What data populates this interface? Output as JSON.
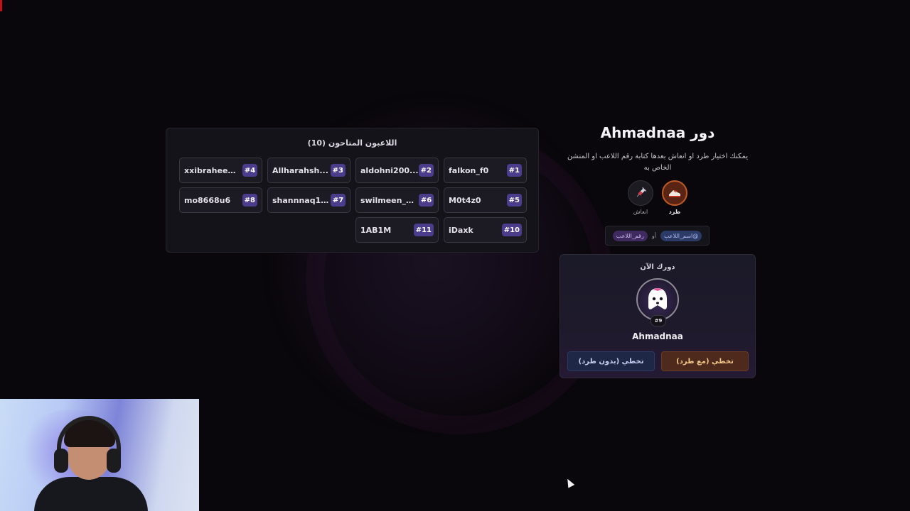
{
  "players_panel": {
    "title": "اللاعبون المتاحون (10)",
    "players": [
      {
        "name": "falkon_f0",
        "num": "#1"
      },
      {
        "name": "aldohni200...",
        "num": "#2"
      },
      {
        "name": "Allharahsh...",
        "num": "#3"
      },
      {
        "name": "xxibraheem...",
        "num": "#4"
      },
      {
        "name": "M0t4z0",
        "num": "#5"
      },
      {
        "name": "swilmeen_a...",
        "num": "#6"
      },
      {
        "name": "shannnaq10...",
        "num": "#7"
      },
      {
        "name": "mo8668u6",
        "num": "#8"
      },
      {
        "name": "iDaxk",
        "num": "#10"
      },
      {
        "name": "1AB1M",
        "num": "#11"
      }
    ]
  },
  "turn": {
    "title": "دور Ahmadnaa",
    "description": "يمكنك اختيار طرد او انعاش بعدها كتابة رقم اللاعب او المنشن الخاص به",
    "actions": [
      {
        "label": "طرد",
        "icon": "kick-shoe-icon"
      },
      {
        "label": "انعاش",
        "icon": "syringe-icon"
      }
    ],
    "hint": {
      "tag_name": "@اسم_اللاعب",
      "or": "أو",
      "tag_number": "رقم_اللاعب"
    }
  },
  "current": {
    "label": "دورك الآن",
    "avatar_icon": "ghost-avatar-icon",
    "number": "#9",
    "name": "Ahmadnaa",
    "btn_kick": "تخطي (مع طرد)",
    "btn_no_kick": "تخطي (بدون طرد)"
  },
  "colors": {
    "accent_purple": "#4b3d8c",
    "kick_orange": "#c15a22",
    "background": "#09070b"
  }
}
